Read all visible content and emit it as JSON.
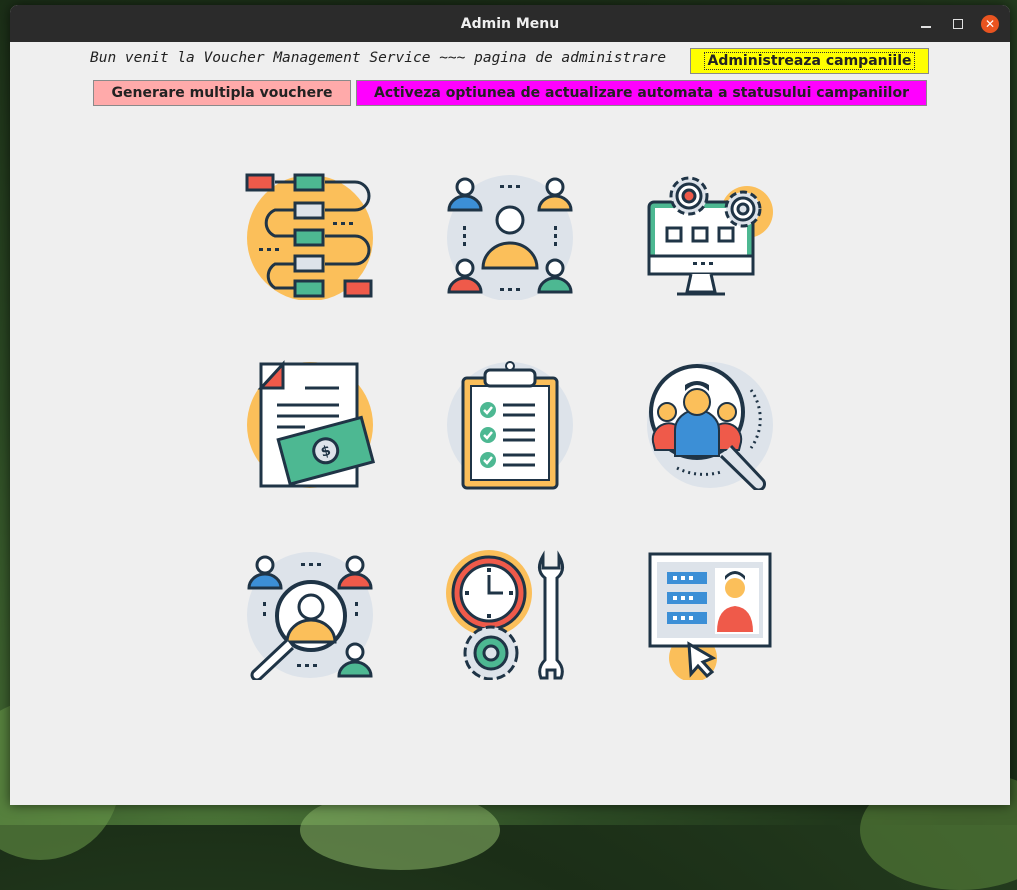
{
  "window": {
    "title": "Admin Menu"
  },
  "header": {
    "welcome_text": "Bun venit la Voucher Management Service ~~~ pagina de administrare",
    "campaigns_button": "Administreaza campaniile",
    "vouchers_button": "Generare multipla vouchere",
    "auto_status_button": "Activeza optiunea de actualizare automata a statusului campaniilor"
  },
  "icons": [
    "workflow-icon",
    "team-network-icon",
    "computer-settings-icon",
    "invoice-money-icon",
    "checklist-icon",
    "people-search-icon",
    "user-search-network-icon",
    "time-tools-icon",
    "profile-presentation-icon"
  ],
  "colors": {
    "campaigns_btn": "#ffff00",
    "vouchers_btn": "#ffaaaa",
    "auto_btn": "#ff00ff",
    "close_btn": "#e95420"
  }
}
